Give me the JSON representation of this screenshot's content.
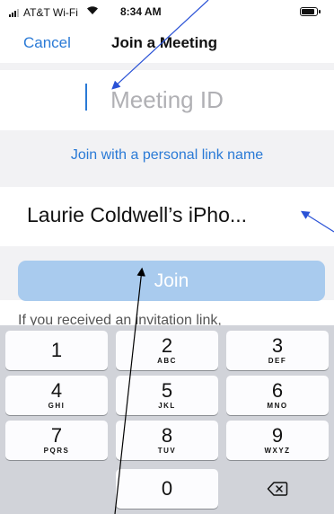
{
  "status_bar": {
    "carrier": "AT&T Wi-Fi",
    "wifi_icon": "wifi-icon",
    "time": "8:34 AM",
    "battery_icon": "battery-icon"
  },
  "nav": {
    "cancel": "Cancel",
    "title": "Join a Meeting"
  },
  "meeting_id": {
    "placeholder": "Meeting ID",
    "value": ""
  },
  "personal_link": "Join with a personal link name",
  "device_name": "Laurie Coldwell’s iPho...",
  "join_button": "Join",
  "hint": "If you received an invitation link,",
  "keypad": {
    "keys": [
      {
        "num": "1",
        "letters": ""
      },
      {
        "num": "2",
        "letters": "ABC"
      },
      {
        "num": "3",
        "letters": "DEF"
      },
      {
        "num": "4",
        "letters": "GHI"
      },
      {
        "num": "5",
        "letters": "JKL"
      },
      {
        "num": "6",
        "letters": "MNO"
      },
      {
        "num": "7",
        "letters": "PQRS"
      },
      {
        "num": "8",
        "letters": "TUV"
      },
      {
        "num": "9",
        "letters": "WXYZ"
      },
      {
        "num": "0",
        "letters": ""
      }
    ],
    "delete_icon": "backspace-icon"
  },
  "colors": {
    "accent": "#2a7ad6",
    "join_disabled": "#a9cbee",
    "keyboard_bg": "#d1d3d9"
  }
}
